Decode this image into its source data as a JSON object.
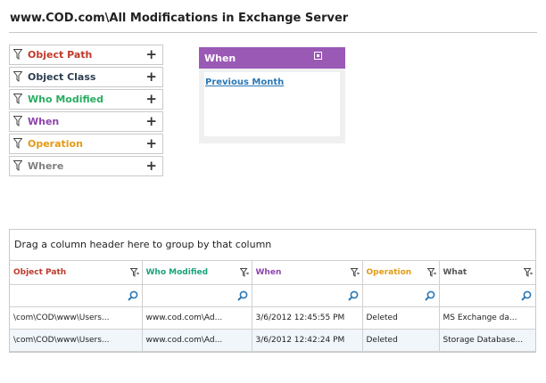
{
  "page": {
    "title": "www.COD.com\\All Modifications in Exchange Server"
  },
  "filters": [
    {
      "label": "Object Path",
      "color": "#c0392b"
    },
    {
      "label": "Object Class",
      "color": "#2c3e50"
    },
    {
      "label": "Who Modified",
      "color": "#27ae60"
    },
    {
      "label": "When",
      "color": "#8e44ad"
    },
    {
      "label": "Operation",
      "color": "#e39a14"
    },
    {
      "label": "Where",
      "color": "#7f7f7f"
    }
  ],
  "filter_icon": "funnel-icon",
  "add_icon": "+",
  "when_panel": {
    "title": "When",
    "header_color": "#9b59b6",
    "link": "Previous Month"
  },
  "grid": {
    "group_hint": "Drag a column header here to group by that column",
    "columns": [
      {
        "label": "Object Path",
        "color": "#c0392b"
      },
      {
        "label": "Who Modified",
        "color": "#1aa37a"
      },
      {
        "label": "When",
        "color": "#8e44ad"
      },
      {
        "label": "Operation",
        "color": "#e39a14"
      },
      {
        "label": "What",
        "color": "#555555"
      }
    ],
    "rows": [
      [
        "\\com\\COD\\www\\Users...",
        "www.cod.com\\Ad...",
        "3/6/2012 12:45:55 PM",
        "Deleted",
        "MS Exchange da..."
      ],
      [
        "\\com\\COD\\www\\Users...",
        "www.cod.com\\Ad...",
        "3/6/2012 12:42:24 PM",
        "Deleted",
        "Storage Database..."
      ]
    ],
    "status_color": "#d0021b"
  }
}
